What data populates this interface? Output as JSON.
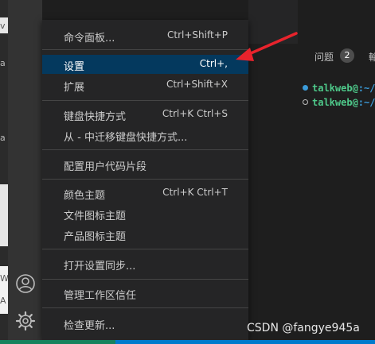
{
  "menu": {
    "items": [
      {
        "label": "命令面板...",
        "shortcut": "Ctrl+Shift+P"
      },
      {
        "label": "设置",
        "shortcut": "Ctrl+,"
      },
      {
        "label": "扩展",
        "shortcut": "Ctrl+Shift+X"
      },
      {
        "label": "键盘快捷方式",
        "shortcut": "Ctrl+K Ctrl+S"
      },
      {
        "label": "从 - 中迁移键盘快捷方式...",
        "shortcut": ""
      },
      {
        "label": "配置用户代码片段",
        "shortcut": ""
      },
      {
        "label": "颜色主题",
        "shortcut": "Ctrl+K Ctrl+T"
      },
      {
        "label": "文件图标主题",
        "shortcut": ""
      },
      {
        "label": "产品图标主题",
        "shortcut": ""
      },
      {
        "label": "打开设置同步...",
        "shortcut": ""
      },
      {
        "label": "管理工作区信任",
        "shortcut": ""
      },
      {
        "label": "检查更新...",
        "shortcut": ""
      }
    ],
    "selected_item": "设置"
  },
  "panel": {
    "problems_label": "问题",
    "problems_count": "2",
    "more_tab": "輸"
  },
  "terminal": {
    "lines": [
      {
        "user": "talkweb@",
        "path": ":~/"
      },
      {
        "user": "talkweb@",
        "path": ":~/"
      }
    ]
  },
  "activity_bar": {
    "icons": [
      "account-icon",
      "manage-gear-icon"
    ]
  },
  "left_strip": {
    "fragments": [
      "v",
      "a",
      "a",
      "W",
      "A"
    ]
  },
  "watermark": "CSDN @fangye945a",
  "colors": {
    "menu_bg": "#252526",
    "selected_bg": "#04395e",
    "arrow": "#e8232c",
    "status_bar": "#007acc"
  }
}
